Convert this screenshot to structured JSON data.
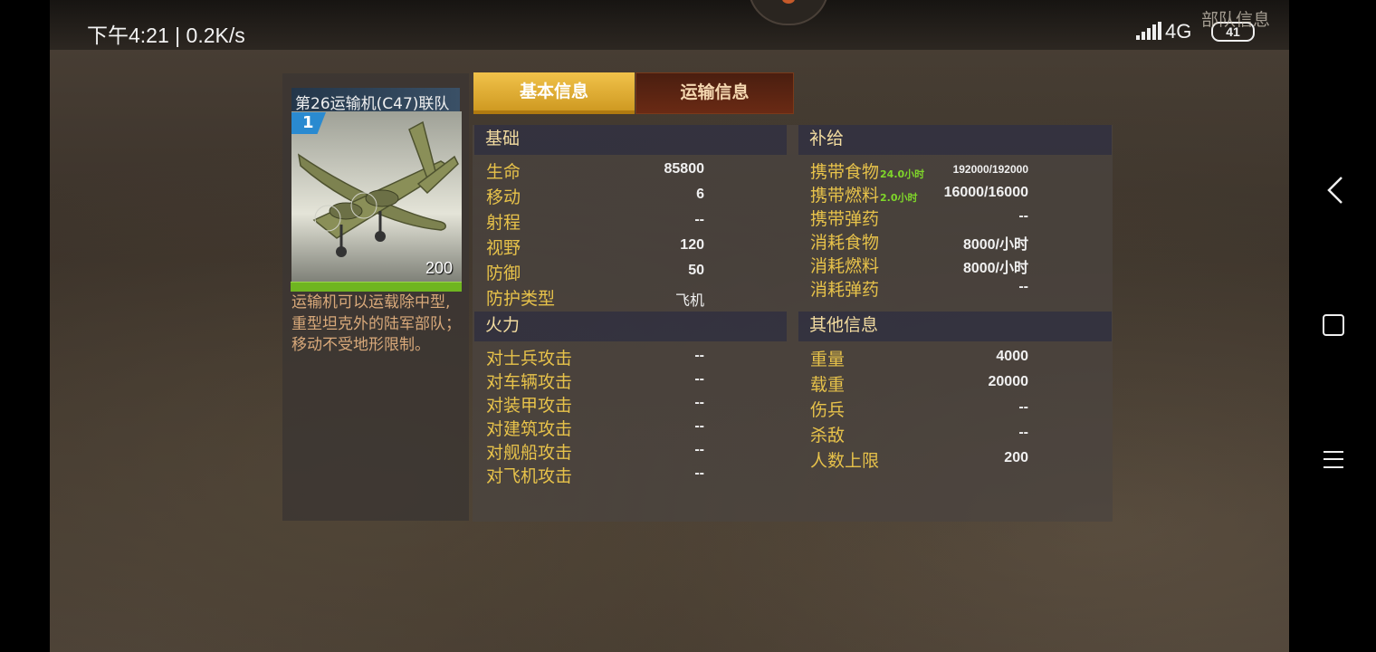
{
  "status_bar": {
    "time": "下午4:21",
    "speed": "0.2K/s",
    "network": "4G",
    "battery": "41"
  },
  "window": {
    "title": "部队信息",
    "close_label": "✕"
  },
  "unit": {
    "name": "第26运输机(C47)联队",
    "level": "1",
    "count": "200",
    "hp_fraction": 1.0,
    "description": "运输机可以运载除中型,重型坦克外的陆军部队；移动不受地形限制。"
  },
  "tabs": [
    {
      "label": "基本信息",
      "active": true
    },
    {
      "label": "运输信息",
      "active": false
    }
  ],
  "sections": {
    "basic": {
      "title": "基础",
      "rows": [
        {
          "label": "生命",
          "value": "85800"
        },
        {
          "label": "移动",
          "value": "6"
        },
        {
          "label": "射程",
          "value": "--"
        },
        {
          "label": "视野",
          "value": "120"
        },
        {
          "label": "防御",
          "value": "50"
        },
        {
          "label": "防护类型",
          "value": "飞机"
        }
      ]
    },
    "firepower": {
      "title": "火力",
      "rows": [
        {
          "label": "对士兵攻击",
          "value": "--"
        },
        {
          "label": "对车辆攻击",
          "value": "--"
        },
        {
          "label": "对装甲攻击",
          "value": "--"
        },
        {
          "label": "对建筑攻击",
          "value": "--"
        },
        {
          "label": "对舰船攻击",
          "value": "--"
        },
        {
          "label": "对飞机攻击",
          "value": "--"
        }
      ]
    },
    "supply": {
      "title": "补给",
      "rows": [
        {
          "label": "携带食物",
          "sub": "24.0小时",
          "value": "192000/192000"
        },
        {
          "label": "携带燃料",
          "sub": "2.0小时",
          "value": "16000/16000"
        },
        {
          "label": "携带弹药",
          "sub": "",
          "value": "--"
        },
        {
          "label": "消耗食物",
          "sub": "",
          "value": "8000/小时"
        },
        {
          "label": "消耗燃料",
          "sub": "",
          "value": "8000/小时"
        },
        {
          "label": "消耗弹药",
          "sub": "",
          "value": "--"
        }
      ]
    },
    "other": {
      "title": "其他信息",
      "rows": [
        {
          "label": "重量",
          "value": "4000"
        },
        {
          "label": "载重",
          "value": "20000"
        },
        {
          "label": "伤兵",
          "value": "--"
        },
        {
          "label": "杀敌",
          "value": "--"
        },
        {
          "label": "人数上限",
          "value": "200"
        }
      ]
    }
  },
  "colors": {
    "label": "#e7c24a",
    "value": "#f0f0f0",
    "sub_label": "#7fd62a",
    "tab_active": "#e0b035",
    "tab_inactive": "#5a2412",
    "hp_bar": "#6fb520"
  }
}
